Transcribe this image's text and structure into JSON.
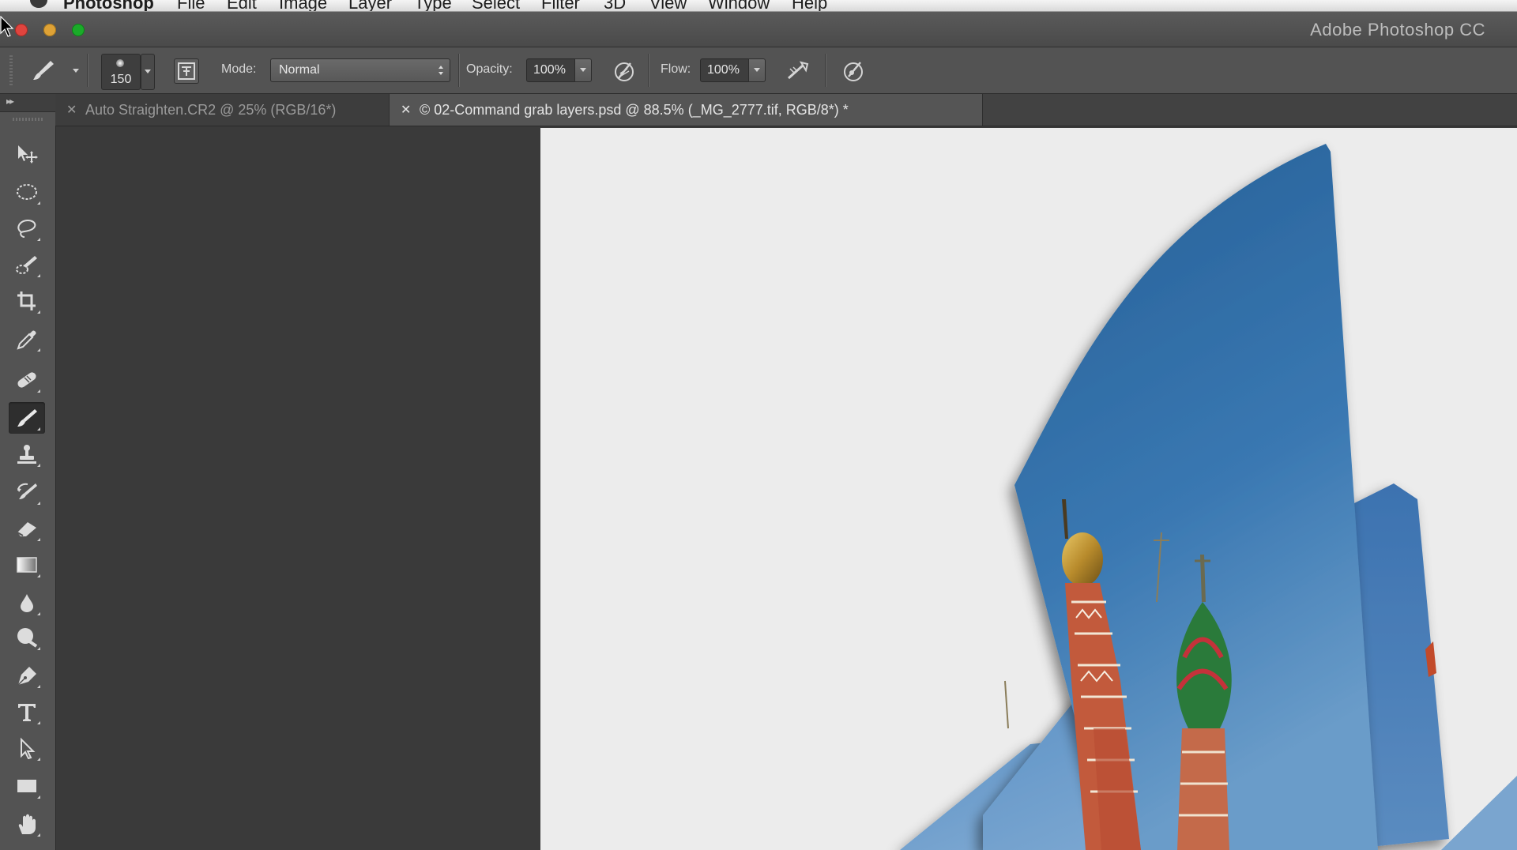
{
  "menubar": {
    "items": [
      "Photoshop",
      "File",
      "Edit",
      "Image",
      "Layer",
      "Type",
      "Select",
      "Filter",
      "3D",
      "View",
      "Window",
      "Help"
    ]
  },
  "window": {
    "title": "Adobe Photoshop CC"
  },
  "options": {
    "brush_size": "150",
    "mode_label": "Mode:",
    "mode_value": "Normal",
    "opacity_label": "Opacity:",
    "opacity_value": "100%",
    "flow_label": "Flow:",
    "flow_value": "100%"
  },
  "tabs": [
    {
      "label": "Auto Straighten.CR2 @ 25% (RGB/16*)",
      "active": false
    },
    {
      "label": "© 02-Command grab layers.psd @ 88.5% (_MG_2777.tif, RGB/8*) *",
      "active": true
    }
  ],
  "tools": [
    "move-tool",
    "elliptical-marquee-tool",
    "lasso-tool",
    "quick-selection-tool",
    "crop-tool",
    "eyedropper-tool",
    "spot-healing-brush-tool",
    "brush-tool",
    "clone-stamp-tool",
    "history-brush-tool",
    "eraser-tool",
    "gradient-tool",
    "blur-tool",
    "dodge-tool",
    "pen-tool",
    "type-tool",
    "path-selection-tool",
    "rectangle-tool",
    "hand-tool"
  ],
  "active_tool": "brush-tool",
  "colors": {
    "ui_dark": "#3a3a3a",
    "panel": "#535353",
    "canvas_bg": "#ececec",
    "sky_blue": "#2f6fa8"
  }
}
